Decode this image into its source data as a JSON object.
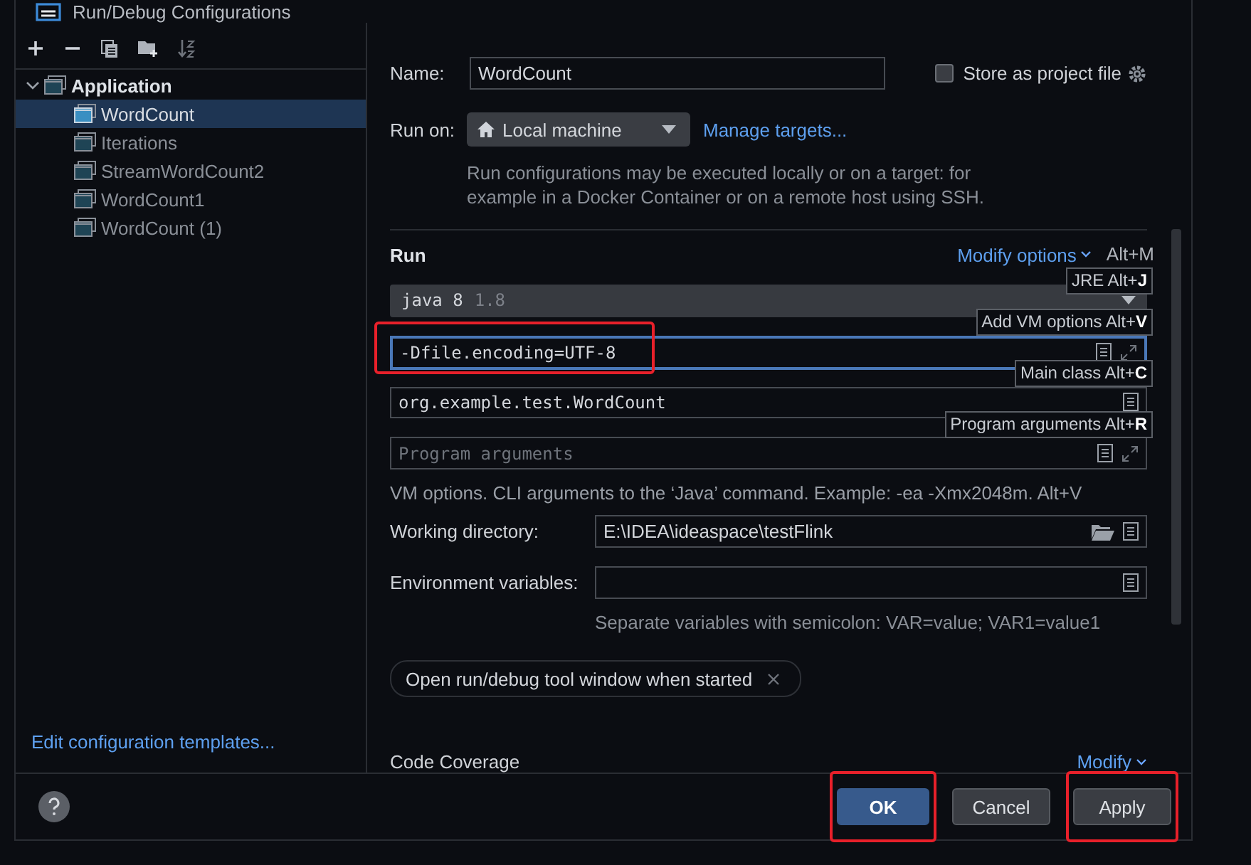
{
  "window": {
    "title": "Run/Debug Configurations"
  },
  "tree": {
    "items": [
      {
        "label": "Application",
        "expanded": true,
        "children": [
          {
            "label": "WordCount",
            "selected": true
          },
          {
            "label": "Iterations",
            "selected": false
          },
          {
            "label": "StreamWordCount2",
            "selected": false
          },
          {
            "label": "WordCount1",
            "selected": false
          },
          {
            "label": "WordCount (1)",
            "selected": false
          }
        ]
      }
    ]
  },
  "edit_templates_link": "Edit configuration templates...",
  "name": {
    "label": "Name:",
    "value": "WordCount"
  },
  "store_as_project_file": {
    "label": "Store as project file",
    "checked": false
  },
  "run_on": {
    "label": "Run on:",
    "value": "Local machine",
    "link": "Manage targets..."
  },
  "run_on_hint": "Run configurations may be executed locally or on a target: for example in a Docker Container or on a remote host using SSH.",
  "run_section": {
    "title": "Run",
    "modify_link": "Modify options",
    "modify_shortcut": "Alt+M"
  },
  "jre": {
    "value": "java 8",
    "version": "1.8"
  },
  "vm_options": {
    "value": "-Dfile.encoding=UTF-8",
    "focused": true,
    "highlighted": true
  },
  "main_class": {
    "value": "org.example.test.WordCount"
  },
  "program_arguments": {
    "placeholder": "Program arguments"
  },
  "shortcut_hints": [
    {
      "text": "JRE Alt+**J**"
    },
    {
      "text": "Add VM options Alt+**V**"
    },
    {
      "text": "Main class Alt+**C**"
    },
    {
      "text": "Program arguments Alt+**R**"
    }
  ],
  "vm_hint": "VM options. CLI arguments to the ‘Java’ command. Example: -ea -Xmx2048m. Alt+V",
  "working_directory": {
    "label": "Working directory:",
    "value": "E:\\IDEA\\ideaspace\\testFlink"
  },
  "environment_variables": {
    "label": "Environment variables:"
  },
  "env_hint": "Separate variables with semicolon: VAR=value; VAR1=value1",
  "option_chips": [
    {
      "label": "Open run/debug tool window when started"
    }
  ],
  "code_coverage": {
    "title": "Code Coverage",
    "modify_link": "Modify"
  },
  "buttons": [
    {
      "label": "OK",
      "kind": "primary",
      "highlighted": true
    },
    {
      "label": "Cancel",
      "kind": "secondary",
      "highlighted": false
    },
    {
      "label": "Apply",
      "kind": "secondary",
      "highlighted": true
    }
  ]
}
